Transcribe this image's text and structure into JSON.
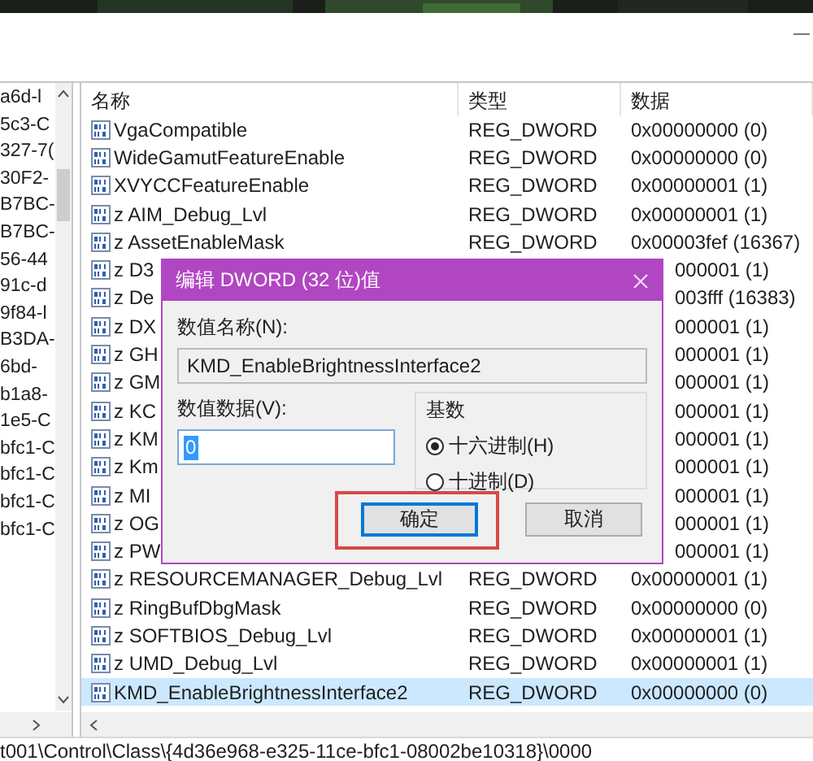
{
  "tree": {
    "items": [
      "a6d-l",
      "5c3-C",
      "327-7(",
      "30F2-",
      "B7BC-",
      "B7BC-",
      "56-44",
      "91c-d",
      "9f84-l",
      "B3DA-",
      "6bd-",
      "b1a8-",
      "1e5-C",
      "bfc1-C",
      "bfc1-C",
      "bfc1-C",
      "bfc1-C"
    ]
  },
  "list": {
    "columns": [
      "名称",
      "类型",
      "数据"
    ],
    "rows": [
      {
        "name": "VgaCompatible",
        "type": "REG_DWORD",
        "data": "0x00000000 (0)",
        "selected": false
      },
      {
        "name": "WideGamutFeatureEnable",
        "type": "REG_DWORD",
        "data": "0x00000000 (0)",
        "selected": false
      },
      {
        "name": "XVYCCFeatureEnable",
        "type": "REG_DWORD",
        "data": "0x00000001 (1)",
        "selected": false
      },
      {
        "name": "z AIM_Debug_Lvl",
        "type": "REG_DWORD",
        "data": "0x00000001 (1)",
        "selected": false
      },
      {
        "name": "z AssetEnableMask",
        "type": "REG_DWORD",
        "data": "0x00003fef (16367)",
        "selected": false
      },
      {
        "name": "z D3",
        "data": "000001 (1)",
        "selected": false
      },
      {
        "name": "z De",
        "data": "003fff (16383)",
        "selected": false
      },
      {
        "name": "z DX",
        "data": "000001 (1)",
        "selected": false
      },
      {
        "name": "z GH",
        "data": "000001 (1)",
        "selected": false
      },
      {
        "name": "z GM",
        "data": "000001 (1)",
        "selected": false
      },
      {
        "name": "z KC",
        "data": "000001 (1)",
        "selected": false
      },
      {
        "name": "z KM",
        "data": "000001 (1)",
        "selected": false
      },
      {
        "name": "z Km",
        "data": "000001 (1)",
        "selected": false
      },
      {
        "name": "z MI",
        "data": "000001 (1)",
        "selected": false
      },
      {
        "name": "z OG",
        "data": "000001 (1)",
        "selected": false
      },
      {
        "name": "z PW",
        "data": "000001 (1)",
        "selected": false
      },
      {
        "name": "z RESOURCEMANAGER_Debug_Lvl",
        "type": "REG_DWORD",
        "data": "0x00000001 (1)",
        "selected": false
      },
      {
        "name": "z RingBufDbgMask",
        "type": "REG_DWORD",
        "data": "0x00000000 (0)",
        "selected": false
      },
      {
        "name": "z SOFTBIOS_Debug_Lvl",
        "type": "REG_DWORD",
        "data": "0x00000001 (1)",
        "selected": false
      },
      {
        "name": "z UMD_Debug_Lvl",
        "type": "REG_DWORD",
        "data": "0x00000001 (1)",
        "selected": false
      },
      {
        "name": "KMD_EnableBrightnessInterface2",
        "type": "REG_DWORD",
        "data": "0x00000000 (0)",
        "selected": true
      }
    ]
  },
  "dialog": {
    "title": "编辑 DWORD (32 位)值",
    "name_label": "数值名称(N):",
    "name_value": "KMD_EnableBrightnessInterface2",
    "data_label": "数值数据(V):",
    "data_value": "0",
    "base": {
      "label": "基数",
      "options": [
        {
          "label": "十六进制(H)",
          "selected": true
        },
        {
          "label": "十进制(D)",
          "selected": false
        }
      ]
    },
    "buttons": [
      {
        "label": "确定",
        "focused": true,
        "highlighted": true
      },
      {
        "label": "取消",
        "focused": false,
        "highlighted": false
      }
    ]
  },
  "status_bar": "t001\\Control\\Class\\{4d36e968-e325-11ce-bfc1-08002be10318}\\0000"
}
